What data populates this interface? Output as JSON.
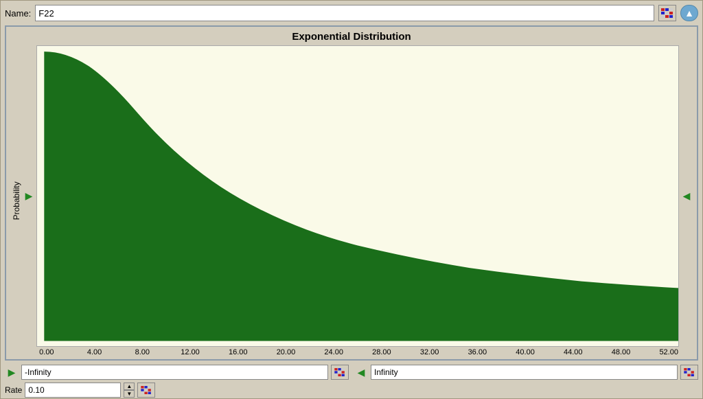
{
  "header": {
    "name_label": "Name:",
    "name_value": "F22",
    "collapse_icon": "▲"
  },
  "chart": {
    "title": "Exponential Distribution",
    "y_axis_label": "Probability",
    "x_ticks": [
      "0.00",
      "4.00",
      "8.00",
      "12.00",
      "16.00",
      "20.00",
      "24.00",
      "28.00",
      "32.00",
      "36.00",
      "40.00",
      "44.00",
      "48.00",
      "52.00"
    ]
  },
  "controls": {
    "left_play_icon": "▶",
    "left_value": "-Infinity",
    "right_arrow_icon": "◀",
    "right_value": "Infinity",
    "rate_label": "Rate",
    "rate_value": "0.10"
  }
}
